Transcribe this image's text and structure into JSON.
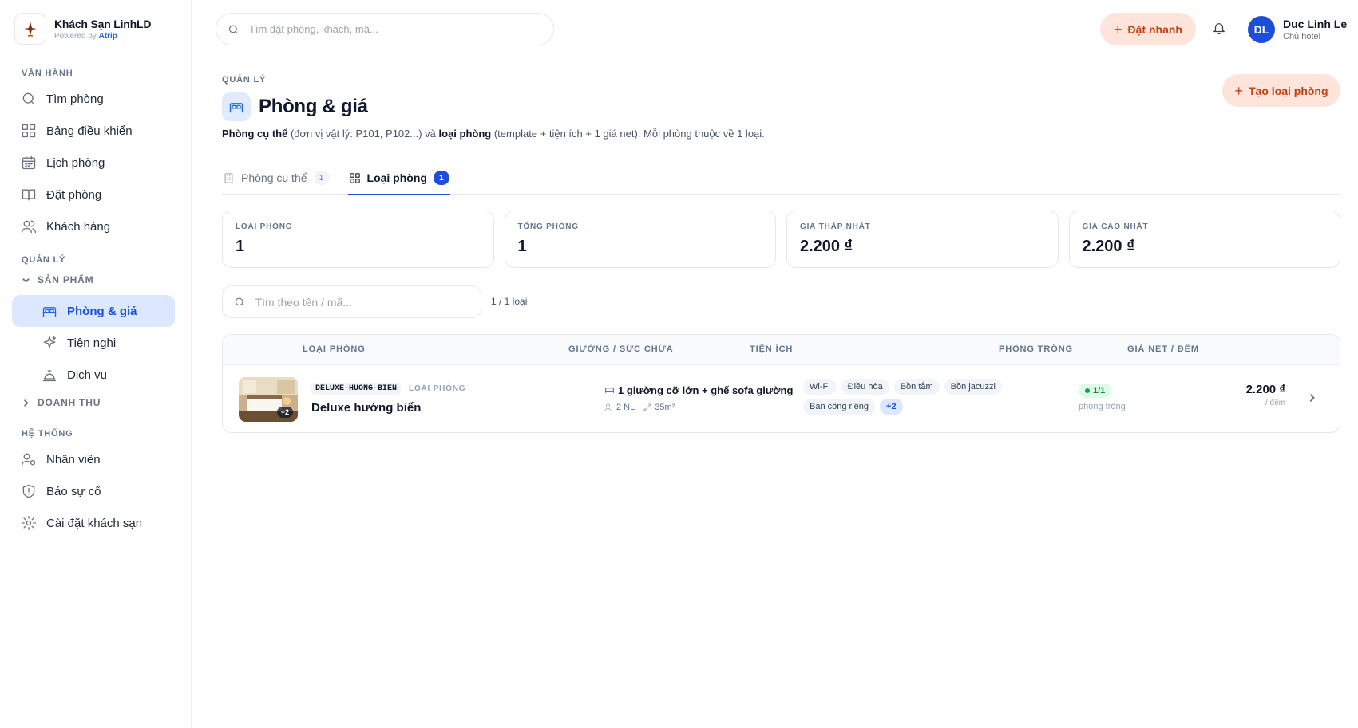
{
  "brand": {
    "name": "Khách Sạn LinhLD",
    "powered_prefix": "Powered by",
    "powered_by": "Atrip"
  },
  "sidebar": {
    "sections": [
      {
        "title": "VẬN HÀNH"
      },
      {
        "title": "QUẢN LÝ"
      },
      {
        "title": "HỆ THỐNG"
      }
    ],
    "items": [
      {
        "label": "Tìm phòng",
        "icon": "search-icon"
      },
      {
        "label": "Bảng điều khiển",
        "icon": "dashboard-icon"
      },
      {
        "label": "Lịch phòng",
        "icon": "calendar-icon"
      },
      {
        "label": "Đặt phòng",
        "icon": "book-icon"
      },
      {
        "label": "Khách hàng",
        "icon": "users-icon"
      },
      {
        "label": "Nhân viên",
        "icon": "user-gear-icon"
      },
      {
        "label": "Báo sự cố",
        "icon": "shield-alert-icon"
      },
      {
        "label": "Cài đặt khách sạn",
        "icon": "gear-icon"
      }
    ],
    "groups": [
      {
        "label": "SẢN PHẨM",
        "expanded": true
      },
      {
        "label": "DOANH THU",
        "expanded": false
      }
    ],
    "sub_items": [
      {
        "label": "Phòng & giá",
        "icon": "bed-icon",
        "active": true
      },
      {
        "label": "Tiện nghi",
        "icon": "sparkle-icon"
      },
      {
        "label": "Dịch vụ",
        "icon": "service-bell-icon"
      }
    ]
  },
  "topbar": {
    "search_placeholder": "Tìm đặt phòng, khách, mã...",
    "quick_label": "Đặt nhanh",
    "user": {
      "initials": "DL",
      "name": "Duc Linh Le",
      "role": "Chủ hotel"
    }
  },
  "page": {
    "breadcrumb": "QUẢN LÝ",
    "title": "Phòng & giá",
    "subtitle": {
      "p1": "Phòng cụ thể",
      "p2": " (đơn vị vật lý: P101, P102...) và ",
      "p3": "loại phòng",
      "p4": " (template + tiện ích + 1 giá net). Mỗi phòng thuộc về 1 loại."
    },
    "create_label": "Tạo loại phòng"
  },
  "tabs": [
    {
      "label": "Phòng cụ thể",
      "count": "1",
      "active": false
    },
    {
      "label": "Loại phòng",
      "count": "1",
      "active": true
    }
  ],
  "stats": [
    {
      "label": "LOẠI PHÒNG",
      "value": "1"
    },
    {
      "label": "TỔNG PHÒNG",
      "value": "1"
    },
    {
      "label": "GIÁ THẤP NHẤT",
      "value": "2.200 ₫"
    },
    {
      "label": "GIÁ CAO NHẤT",
      "value": "2.200 ₫"
    }
  ],
  "list": {
    "search_placeholder": "Tìm theo tên / mã...",
    "count_text": "1 / 1 loại",
    "columns": [
      "LOẠI PHÒNG",
      "GIƯỜNG / SỨC CHỨA",
      "TIỆN ÍCH",
      "PHÒNG TRỐNG",
      "GIÁ NET / ĐÊM"
    ],
    "rows": [
      {
        "photo_more": "+2",
        "code": "DELUXE-HUONG-BIEN",
        "type_label": "LOẠI PHÒNG",
        "name": "Deluxe hướng biển",
        "bed": "1 giường cỡ lớn + ghế sofa giường",
        "capacity": "2 NL",
        "area": "35m²",
        "amenities": [
          "Wi-Fi",
          "Điều hòa",
          "Bồn tắm",
          "Bồn jacuzzi",
          "Ban công riêng"
        ],
        "amenities_more": "+2",
        "vacancy": "1/1",
        "vacancy_label": "phòng trống",
        "price": "2.200 ₫",
        "price_unit": "/ đêm"
      }
    ]
  },
  "colors": {
    "accent": "#1d4ed8",
    "cta_bg": "#ffe4dc",
    "cta_text": "#c2410c",
    "success": "#16a34a"
  }
}
